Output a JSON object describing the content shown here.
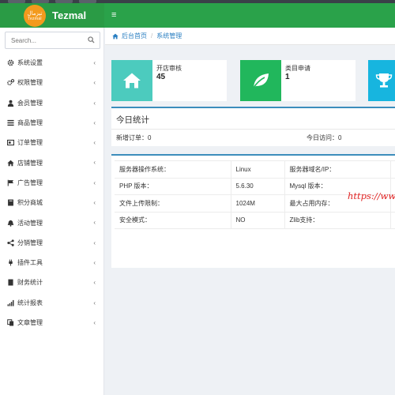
{
  "app": {
    "brand": "Tezmal",
    "logo_text_top": "تېزمال",
    "logo_text_bottom": "Tezmal"
  },
  "colors": {
    "header": "#2aa24a",
    "card_teal": "#4ccbbe",
    "card_green": "#21b75c",
    "card_cyan": "#17b5df",
    "panel_border": "#3c8dbc",
    "link": "#2a7fc2",
    "watermark": "#e02020"
  },
  "search": {
    "placeholder": "Search..."
  },
  "sidebar": {
    "items": [
      {
        "label": "系统设置",
        "icon": "gear-icon"
      },
      {
        "label": "权限管理",
        "icon": "gears-icon"
      },
      {
        "label": "会员管理",
        "icon": "user-icon"
      },
      {
        "label": "商品管理",
        "icon": "list-icon"
      },
      {
        "label": "订单管理",
        "icon": "card-icon"
      },
      {
        "label": "店铺管理",
        "icon": "home-icon"
      },
      {
        "label": "广告管理",
        "icon": "flag-icon"
      },
      {
        "label": "积分商城",
        "icon": "book-icon"
      },
      {
        "label": "活动管理",
        "icon": "bell-icon"
      },
      {
        "label": "分销管理",
        "icon": "share-icon"
      },
      {
        "label": "插件工具",
        "icon": "plug-icon"
      },
      {
        "label": "财务统计",
        "icon": "doc-icon"
      },
      {
        "label": "统计报表",
        "icon": "bar-chart-icon"
      },
      {
        "label": "文章管理",
        "icon": "copy-icon"
      }
    ]
  },
  "breadcrumb": {
    "home": "后台首页",
    "current": "系统管理"
  },
  "cards": [
    {
      "title": "开店审核",
      "value": "45",
      "icon": "home-icon"
    },
    {
      "title": "类目申请",
      "value": "1",
      "icon": "leaf-icon"
    },
    {
      "title": "",
      "value": "",
      "icon": "trophy-icon"
    }
  ],
  "today": {
    "title": "今日统计",
    "new_orders_label": "新增订单：",
    "new_orders": "0",
    "visits_label": "今日访问：",
    "visits": "0"
  },
  "server": {
    "rows": [
      [
        "服务器操作系统：",
        "Linux",
        "服务器域名/IP：",
        ""
      ],
      [
        "PHP 版本：",
        "5.6.30",
        "Mysql 版本：",
        ""
      ],
      [
        "文件上传限制：",
        "1024M",
        "最大占用内存：",
        ""
      ],
      [
        "安全模式：",
        "NO",
        "Zlib支持：",
        ""
      ]
    ]
  },
  "watermark": "https://ww"
}
